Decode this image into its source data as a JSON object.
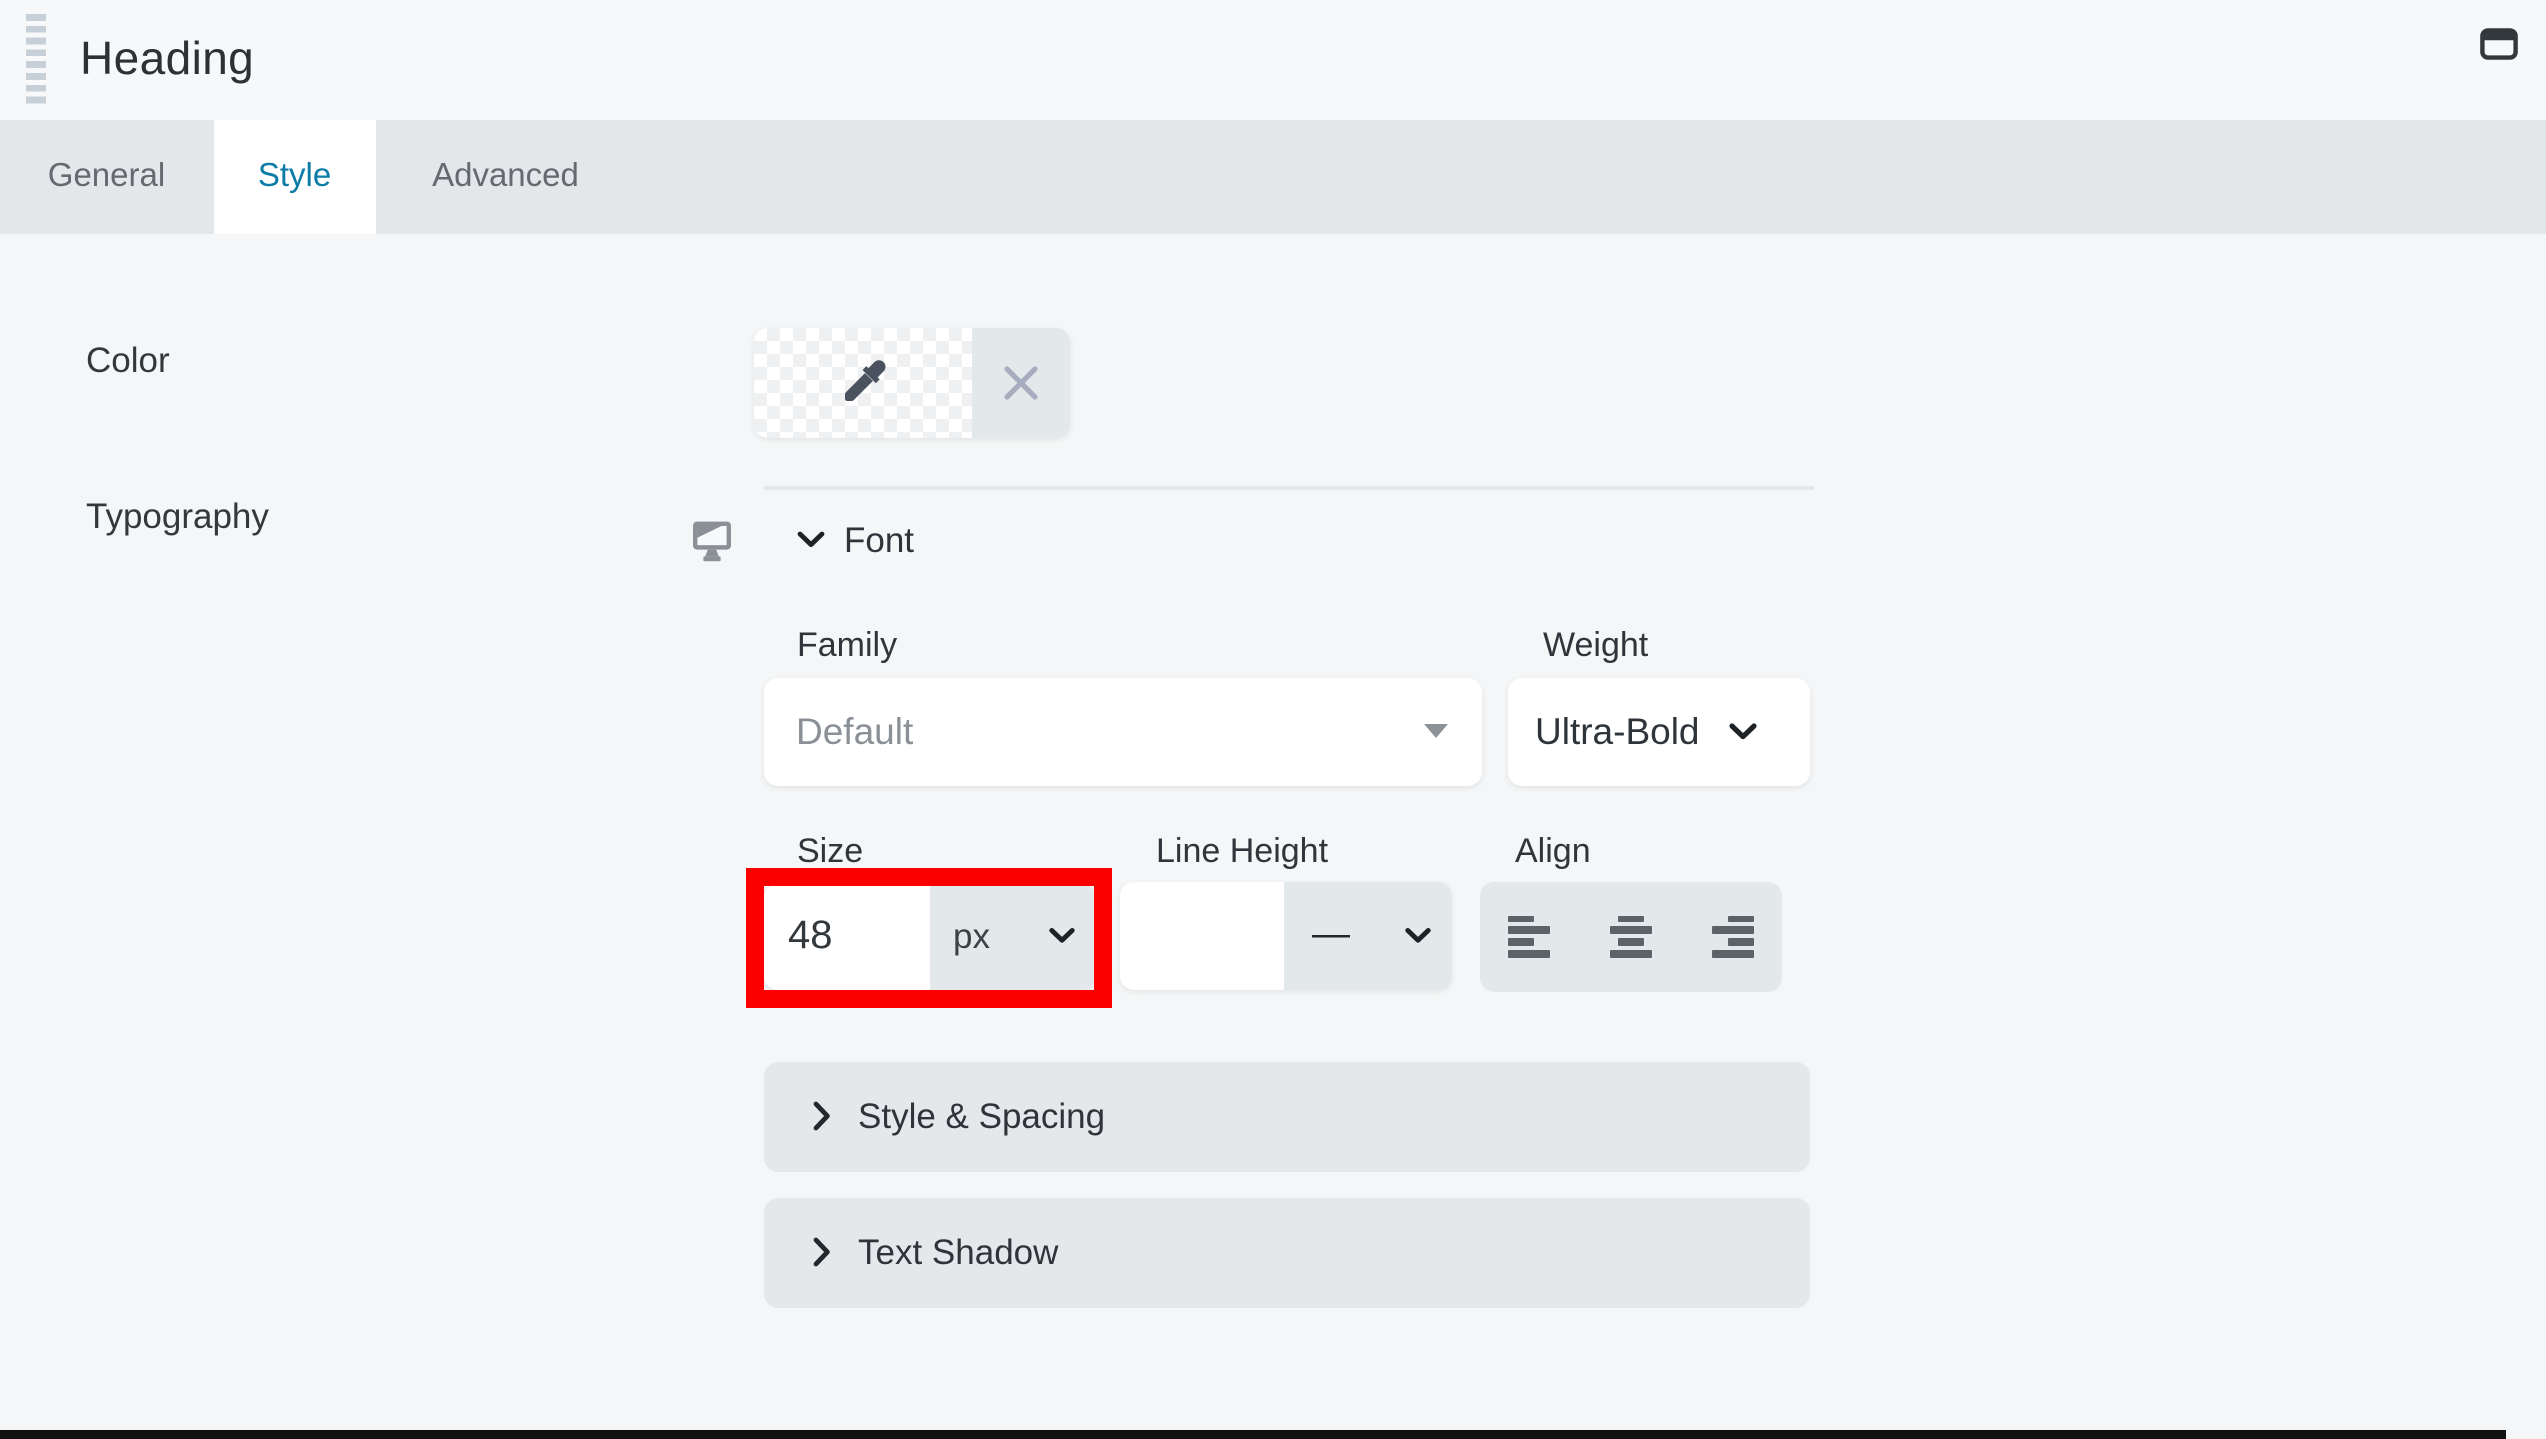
{
  "window": {
    "title": "Heading"
  },
  "tabs": {
    "items": [
      {
        "label": "General",
        "active": false
      },
      {
        "label": "Style",
        "active": true
      },
      {
        "label": "Advanced",
        "active": false
      }
    ]
  },
  "settings": {
    "color": {
      "label": "Color"
    },
    "typography": {
      "label": "Typography",
      "font_group": {
        "title": "Font"
      },
      "family": {
        "label": "Family",
        "value": "Default"
      },
      "weight": {
        "label": "Weight",
        "value": "Ultra-Bold"
      },
      "size": {
        "label": "Size",
        "value": "48",
        "unit": "px"
      },
      "line_height": {
        "label": "Line Height",
        "value": "",
        "unit": "—"
      },
      "align": {
        "label": "Align",
        "options": [
          "align-left",
          "align-center",
          "align-right"
        ]
      },
      "collapsed_sections": [
        {
          "title": "Style & Spacing"
        },
        {
          "title": "Text Shadow"
        }
      ]
    }
  },
  "icons": {
    "drag_handle": "drag-handle",
    "window": "window-icon",
    "responsive_toggle": "monitor-icon",
    "expand_open": "chevron-down-icon",
    "expand_closed": "chevron-right-icon",
    "color_picker": "eyedropper-icon",
    "color_clear": "x-icon",
    "dropdown": "caret-down-icon"
  },
  "annotation": {
    "type": "highlight-box",
    "target": "size-field",
    "color": "#fa0100"
  },
  "colors": {
    "active_tab_text": "#0c7ca6",
    "highlight": "#fa0100",
    "topbar_bg": "#f7f8f9",
    "tabbar_bg": "#e3e7e9",
    "content_bg": "#f4f6f7",
    "control_gray": "#e3e8ea",
    "icon_gray": "#8a9095",
    "text_dark": "#2e343a",
    "bottom_bar": "#111111"
  }
}
